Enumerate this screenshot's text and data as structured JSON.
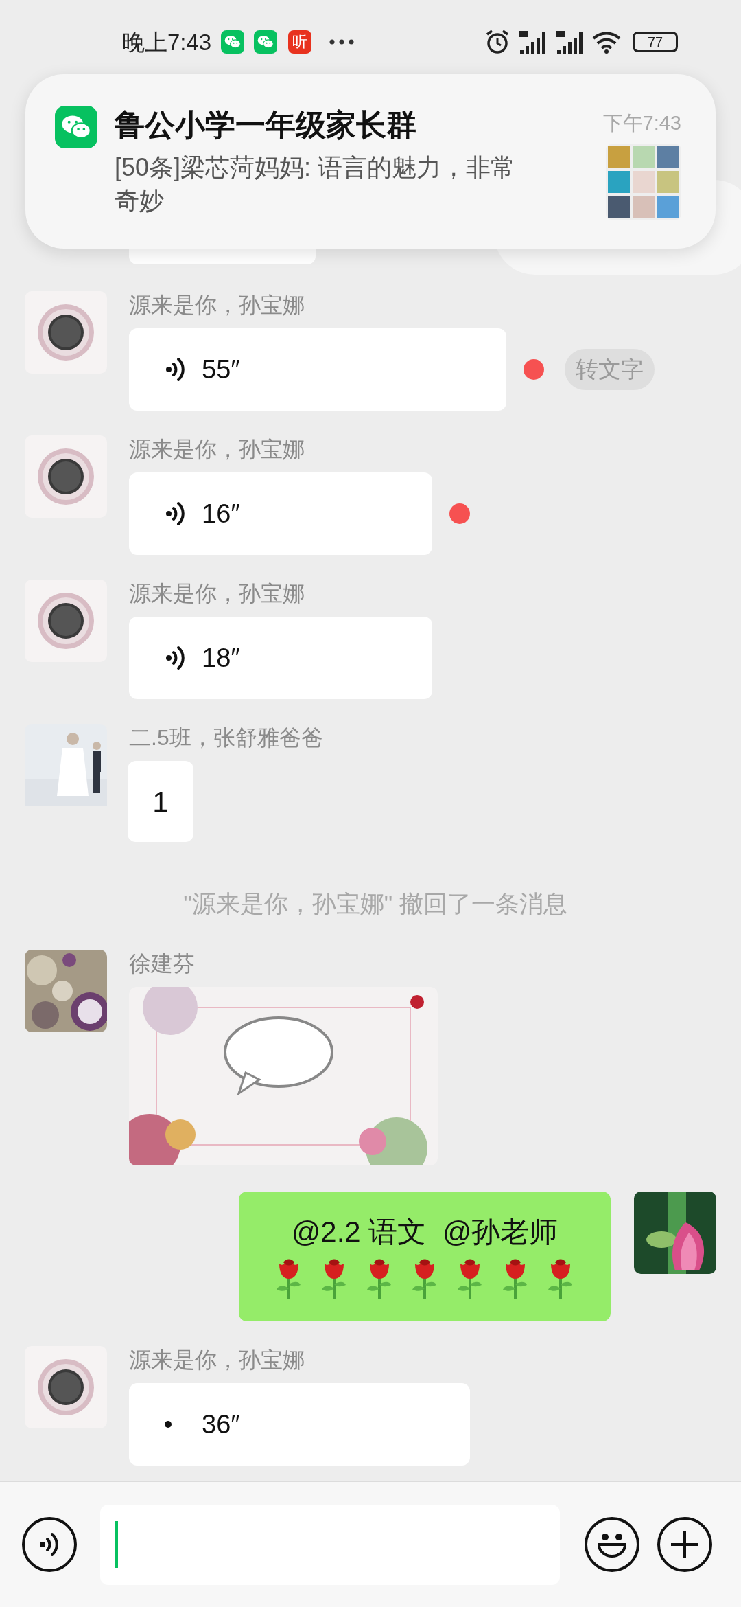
{
  "status_bar": {
    "time": "晚上7:43",
    "app_icons": [
      {
        "kind": "wechat"
      },
      {
        "kind": "wechat"
      },
      {
        "kind": "ting",
        "label": "听"
      }
    ],
    "battery": "77"
  },
  "notification": {
    "title": "鲁公小学一年级家长群",
    "time": "下午7:43",
    "body": "[50条]梁芯菏妈妈: 语言的魅力，非常奇妙"
  },
  "messages": [
    {
      "kind": "voice",
      "sender": "源来是你，孙宝娜",
      "avatar": {
        "kind": "seal"
      },
      "duration": "55″",
      "unread": true,
      "transcribe": "转文字",
      "playing": false,
      "bubble": {
        "kind": "wide"
      }
    },
    {
      "kind": "voice",
      "sender": "源来是你，孙宝娜",
      "avatar": {
        "kind": "seal"
      },
      "duration": "16″",
      "unread": true,
      "playing": false,
      "bubble": {
        "kind": "short"
      }
    },
    {
      "kind": "voice",
      "sender": "源来是你，孙宝娜",
      "avatar": {
        "kind": "seal"
      },
      "duration": "18″",
      "unread": false,
      "playing": false,
      "bubble": {
        "kind": "short"
      }
    },
    {
      "kind": "text",
      "sender": "二.5班，张舒雅爸爸",
      "avatar": {
        "kind": "kids"
      },
      "text": "1"
    },
    {
      "kind": "system",
      "text": "\"源来是你，孙宝娜\" 撤回了一条消息"
    },
    {
      "sender": "徐建芬",
      "avatar": {
        "kind": "flowers"
      }
    },
    {
      "kind": "self_text",
      "avatar": {
        "kind": "lotus"
      },
      "text": "@2.2 语文  @孙老师",
      "emojis": [
        {
          "kind": "rose"
        },
        {
          "kind": "rose"
        },
        {
          "kind": "rose"
        },
        {
          "kind": "rose"
        },
        {
          "kind": "rose"
        },
        {
          "kind": "rose"
        },
        {
          "kind": "rose"
        }
      ]
    },
    {
      "kind": "voice",
      "sender": "源来是你，孙宝娜",
      "avatar": {
        "kind": "seal"
      },
      "duration": "36″",
      "unread": false,
      "playing": true,
      "bubble": {
        "kind": "medium"
      }
    }
  ]
}
